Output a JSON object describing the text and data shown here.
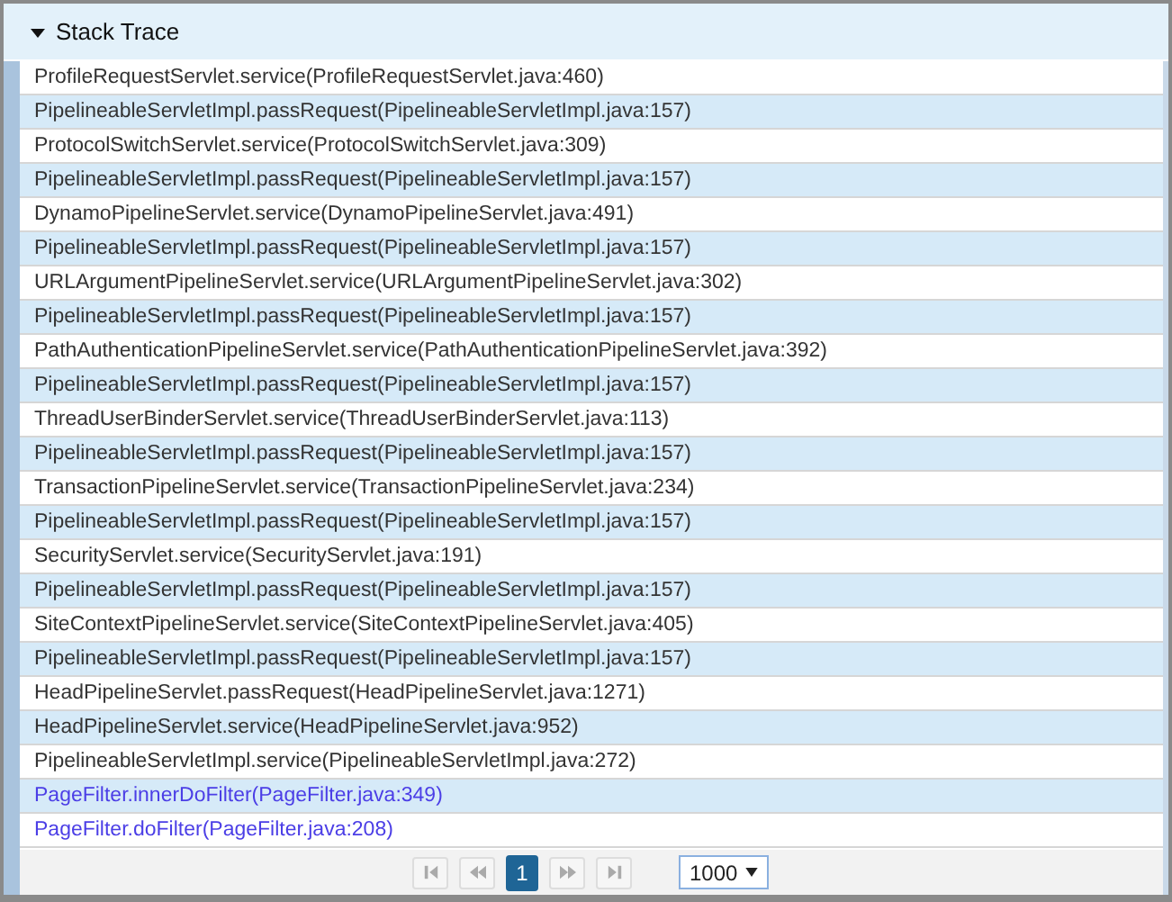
{
  "panel": {
    "title": "Stack Trace",
    "expanded": true
  },
  "frames": [
    {
      "text": "ProfileRequestServlet.service(ProfileRequestServlet.java:460)",
      "kind": "plain"
    },
    {
      "text": "PipelineableServletImpl.passRequest(PipelineableServletImpl.java:157)",
      "kind": "plain"
    },
    {
      "text": "ProtocolSwitchServlet.service(ProtocolSwitchServlet.java:309)",
      "kind": "plain"
    },
    {
      "text": "PipelineableServletImpl.passRequest(PipelineableServletImpl.java:157)",
      "kind": "plain"
    },
    {
      "text": "DynamoPipelineServlet.service(DynamoPipelineServlet.java:491)",
      "kind": "plain"
    },
    {
      "text": "PipelineableServletImpl.passRequest(PipelineableServletImpl.java:157)",
      "kind": "plain"
    },
    {
      "text": "URLArgumentPipelineServlet.service(URLArgumentPipelineServlet.java:302)",
      "kind": "plain"
    },
    {
      "text": "PipelineableServletImpl.passRequest(PipelineableServletImpl.java:157)",
      "kind": "plain"
    },
    {
      "text": "PathAuthenticationPipelineServlet.service(PathAuthenticationPipelineServlet.java:392)",
      "kind": "plain"
    },
    {
      "text": "PipelineableServletImpl.passRequest(PipelineableServletImpl.java:157)",
      "kind": "plain"
    },
    {
      "text": "ThreadUserBinderServlet.service(ThreadUserBinderServlet.java:113)",
      "kind": "plain"
    },
    {
      "text": "PipelineableServletImpl.passRequest(PipelineableServletImpl.java:157)",
      "kind": "plain"
    },
    {
      "text": "TransactionPipelineServlet.service(TransactionPipelineServlet.java:234)",
      "kind": "plain"
    },
    {
      "text": "PipelineableServletImpl.passRequest(PipelineableServletImpl.java:157)",
      "kind": "plain"
    },
    {
      "text": "SecurityServlet.service(SecurityServlet.java:191)",
      "kind": "plain"
    },
    {
      "text": "PipelineableServletImpl.passRequest(PipelineableServletImpl.java:157)",
      "kind": "plain"
    },
    {
      "text": "SiteContextPipelineServlet.service(SiteContextPipelineServlet.java:405)",
      "kind": "plain"
    },
    {
      "text": "PipelineableServletImpl.passRequest(PipelineableServletImpl.java:157)",
      "kind": "plain"
    },
    {
      "text": "HeadPipelineServlet.passRequest(HeadPipelineServlet.java:1271)",
      "kind": "plain"
    },
    {
      "text": "HeadPipelineServlet.service(HeadPipelineServlet.java:952)",
      "kind": "plain"
    },
    {
      "text": "PipelineableServletImpl.service(PipelineableServletImpl.java:272)",
      "kind": "plain"
    },
    {
      "text": "PageFilter.innerDoFilter(PageFilter.java:349)",
      "kind": "link"
    },
    {
      "text": "PageFilter.doFilter(PageFilter.java:208)",
      "kind": "link"
    }
  ],
  "pager": {
    "pages": [
      {
        "label": "1",
        "selected": true
      }
    ],
    "page_size": "1000"
  }
}
